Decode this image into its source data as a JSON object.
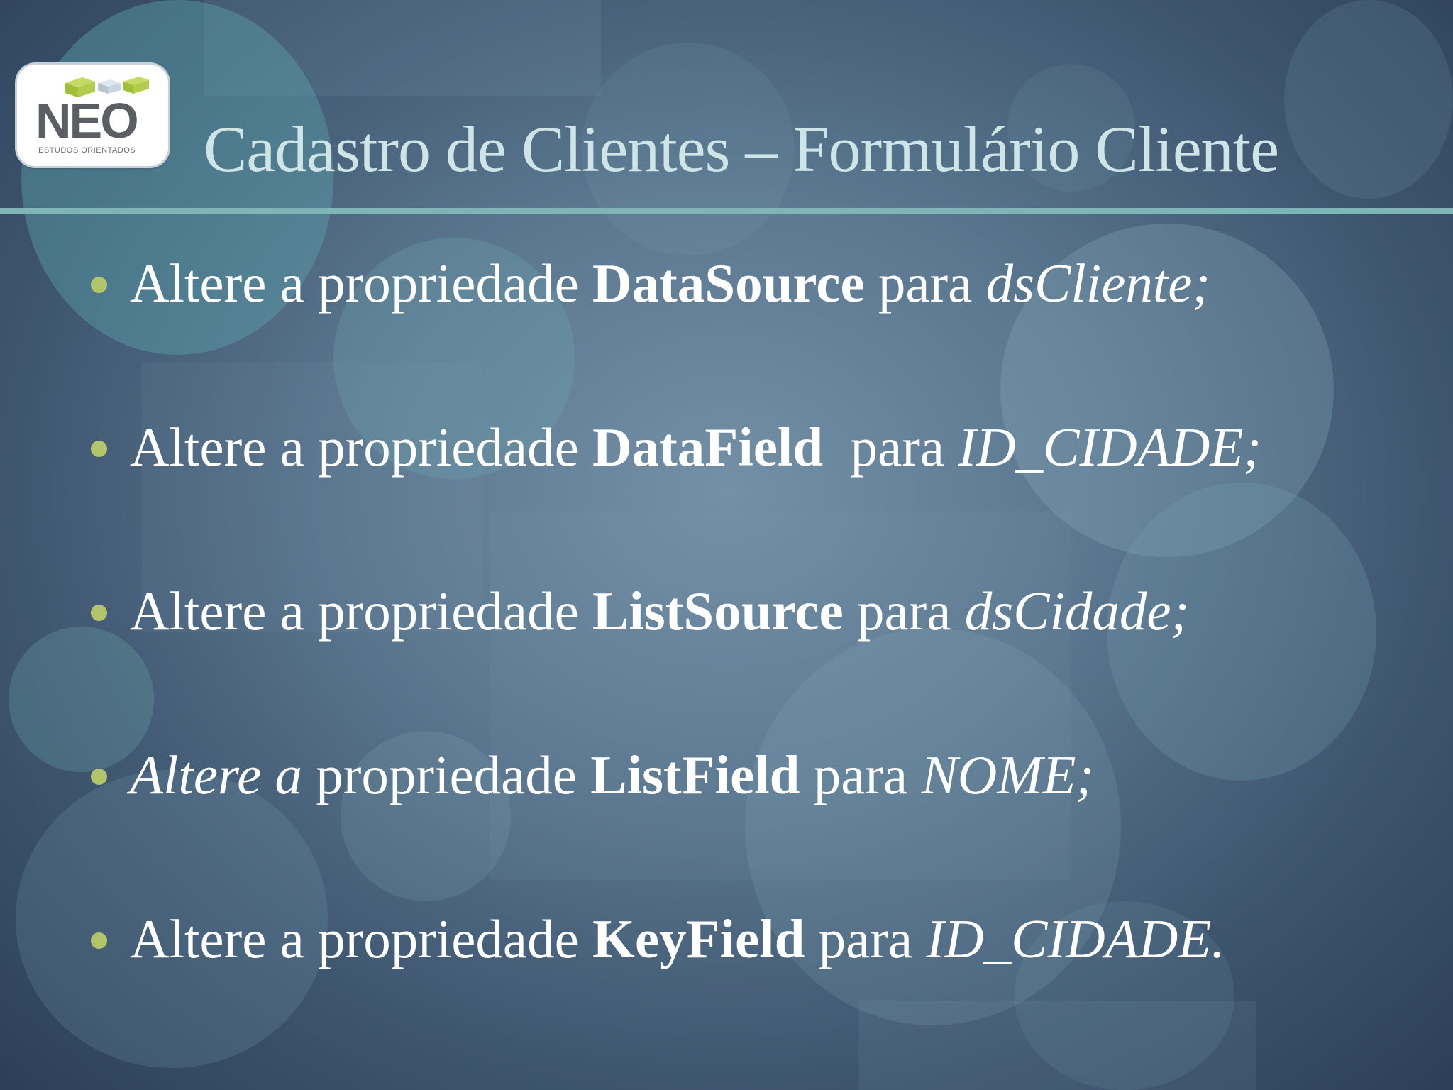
{
  "slide": {
    "background_color": "#4e6782",
    "accent_rule_color": "#7fb6b5",
    "bullet_color": "#b3c56b"
  },
  "logo": {
    "mark": "NEO",
    "subtitle": "ESTUDOS ORIENTADOS"
  },
  "title": "Cadastro de Clientes – Formulário Cliente",
  "bullets": [
    {
      "prefix": "Altere a propriedade ",
      "property": "DataSource",
      "connector": " para ",
      "value": "dsCliente;"
    },
    {
      "prefix": "Altere a propriedade ",
      "property": "DataField",
      "connector": "  para ",
      "value": "ID_CIDADE;"
    },
    {
      "prefix": "Altere a propriedade ",
      "property": "ListSource",
      "connector": " para ",
      "value": "dsCidade;"
    },
    {
      "prefix_italic": "Altere a",
      "prefix": " propriedade ",
      "property": "ListField",
      "connector": " para ",
      "value": "NOME;"
    },
    {
      "prefix": "Altere a propriedade ",
      "property": "KeyField",
      "connector": " para ",
      "value": "ID_CIDADE."
    }
  ]
}
